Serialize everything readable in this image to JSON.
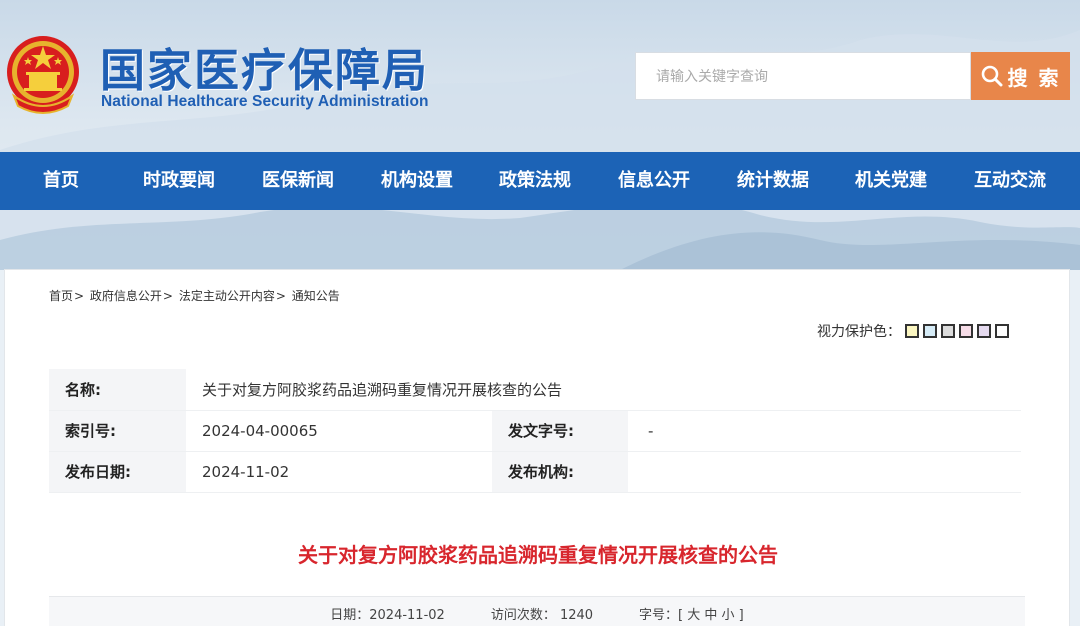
{
  "header": {
    "logo_cn": "国家医疗保障局",
    "logo_en": "National Healthcare Security Administration",
    "search_placeholder": "请输入关键字查询",
    "search_button": "搜 索"
  },
  "nav": {
    "items": [
      "首页",
      "时政要闻",
      "医保新闻",
      "机构设置",
      "政策法规",
      "信息公开",
      "统计数据",
      "机关党建",
      "互动交流"
    ]
  },
  "breadcrumb": [
    "首页",
    "政府信息公开",
    "法定主动公开内容",
    "通知公告"
  ],
  "breadcrumb_sep": ">",
  "vision": {
    "label": "视力保护色：",
    "colors": [
      "#fbf6c1",
      "#d6ecf7",
      "#dcdcdc",
      "#f7dde8",
      "#e6dbf0",
      "#ffffff"
    ]
  },
  "meta": {
    "name_label": "名称:",
    "name_value": "关于对复方阿胶浆药品追溯码重复情况开展核查的公告",
    "index_label": "索引号:",
    "index_value": "2024-04-00065",
    "doc_no_label": "发文字号:",
    "doc_no_value": "-",
    "date_label": "发布日期:",
    "date_value": "2024-11-02",
    "org_label": "发布机构:",
    "org_value": ""
  },
  "article": {
    "title": "关于对复方阿胶浆药品追溯码重复情况开展核查的公告",
    "date_text": "日期：2024-11-02",
    "visits_text": "访问次数： 1240",
    "font_size_text": "字号：[ 大 中 小 ]"
  },
  "colors": {
    "nav_blue": "#1c63b6",
    "logo_blue": "#1f5fb4",
    "search_orange": "#e8864a",
    "title_red": "#d8262d"
  }
}
